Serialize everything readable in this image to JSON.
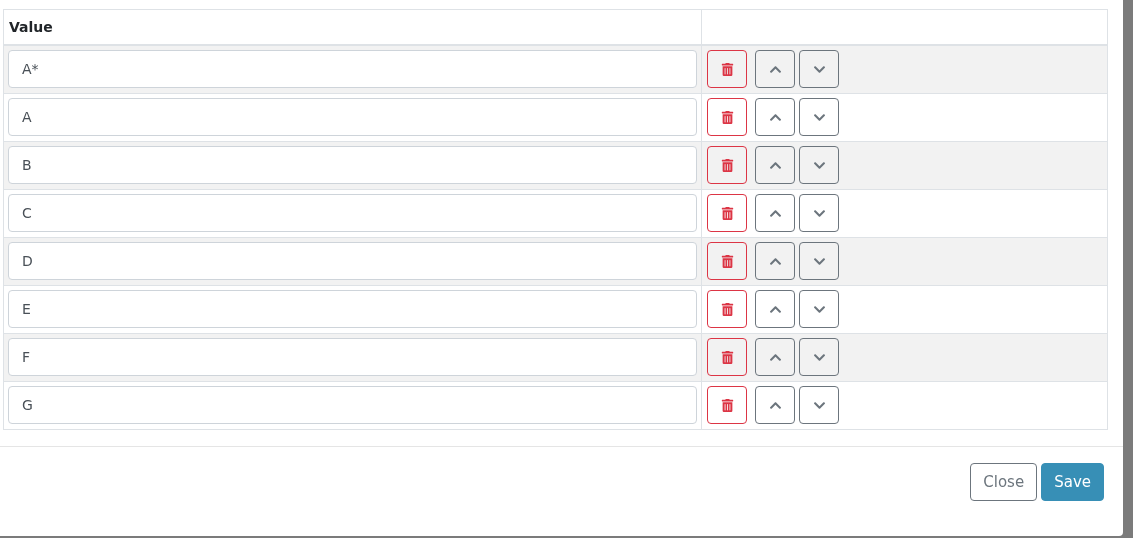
{
  "table": {
    "columns": [
      "Value"
    ],
    "rows": [
      {
        "value": "A*"
      },
      {
        "value": "A"
      },
      {
        "value": "B"
      },
      {
        "value": "C"
      },
      {
        "value": "D"
      },
      {
        "value": "E"
      },
      {
        "value": "F"
      },
      {
        "value": "G"
      }
    ]
  },
  "footer": {
    "buttons": [
      {
        "label": "Close",
        "kind": "secondary"
      },
      {
        "label": "Save",
        "kind": "primary"
      }
    ]
  }
}
